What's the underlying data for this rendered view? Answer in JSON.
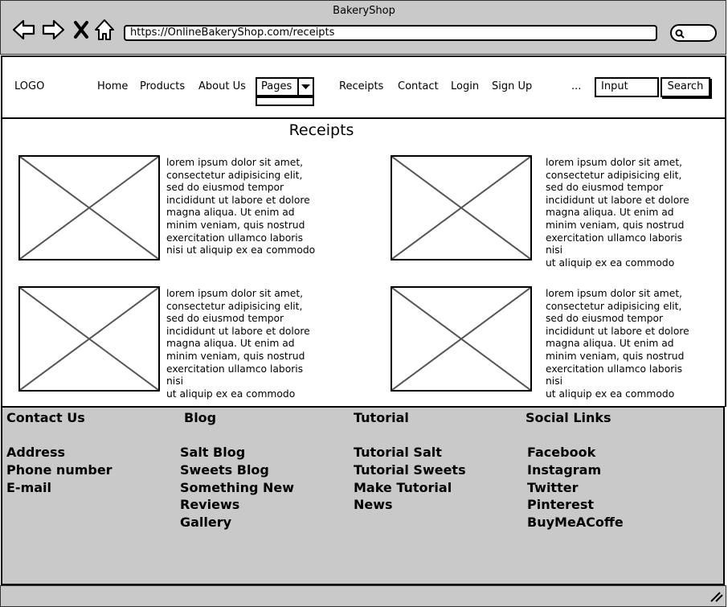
{
  "window": {
    "title": "BakeryShop"
  },
  "browser": {
    "url": "https://OnlineBakeryShop.com/receipts"
  },
  "nav": {
    "logo": "LOGO",
    "home": "Home",
    "products": "Products",
    "about": "About Us",
    "pages": "Pages",
    "receipts": "Receipts",
    "contact": "Contact",
    "login": "Login",
    "signup": "Sign Up",
    "more": "...",
    "input_value": "Input",
    "search_label": "Search"
  },
  "main": {
    "title": "Receipts",
    "cards": [
      {
        "lines": [
          "lorem ipsum dolor sit amet,",
          "consectetur adipisicing elit,",
          "sed do eiusmod tempor",
          "incididunt ut labore et dolore",
          "magna aliqua. Ut enim ad",
          "minim veniam, quis nostrud",
          "exercitation ullamco laboris",
          "nisi ut aliquip ex ea commodo"
        ]
      },
      {
        "lines": [
          "lorem ipsum dolor sit amet,",
          "consectetur adipisicing elit,",
          "sed do eiusmod tempor",
          "incididunt ut labore et dolore",
          "magna aliqua. Ut enim ad",
          "minim veniam, quis nostrud",
          "exercitation ullamco laboris nisi",
          "ut aliquip ex ea commodo"
        ]
      },
      {
        "lines": [
          "lorem ipsum dolor sit amet,",
          "consectetur adipisicing elit,",
          "sed do eiusmod tempor",
          "incididunt ut labore et dolore",
          "magna aliqua. Ut enim ad",
          "minim veniam, quis nostrud",
          "exercitation ullamco laboris nisi",
          "ut aliquip ex ea commodo"
        ]
      },
      {
        "lines": [
          "lorem ipsum dolor sit amet,",
          "consectetur adipisicing elit,",
          "sed do eiusmod tempor",
          "incididunt ut labore et dolore",
          "magna aliqua. Ut enim ad",
          "minim veniam, quis nostrud",
          "exercitation ullamco laboris nisi",
          "ut aliquip ex ea commodo"
        ]
      }
    ]
  },
  "footer": {
    "contact": {
      "heading": "Contact Us",
      "links": [
        "Address",
        "Phone number",
        "E-mail"
      ]
    },
    "blog": {
      "heading": "Blog",
      "links": [
        "Salt Blog",
        "Sweets Blog",
        "Something New",
        "Reviews",
        "Gallery"
      ]
    },
    "tutorial": {
      "heading": "Tutorial",
      "links": [
        "Tutorial Salt",
        "Tutorial Sweets",
        "Make Tutorial",
        "News"
      ]
    },
    "social": {
      "heading": "Social Links",
      "links": [
        "Facebook",
        "Instagram",
        "Twitter",
        "Pinterest",
        "BuyMeACoffe"
      ]
    }
  },
  "icons": {
    "back": "arrow-left-icon",
    "forward": "arrow-right-icon",
    "close": "close-icon",
    "home": "home-icon",
    "search": "search-icon",
    "dropdown": "caret-down-icon",
    "resize": "resize-grip-icon"
  }
}
